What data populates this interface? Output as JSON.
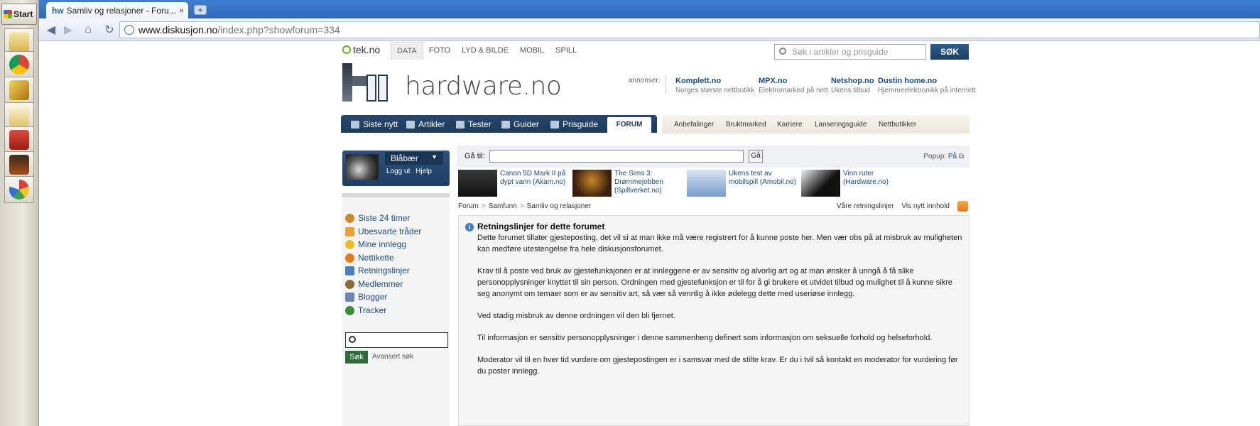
{
  "os": {
    "start_label": "Start",
    "icons": [
      "explorer-icon",
      "chrome-icon",
      "editor-icon",
      "mail-icon",
      "books-icon",
      "video-icon",
      "paint-icon"
    ]
  },
  "browser": {
    "tab_title": "Samliv og relasjoner - Foru...",
    "tab_close": "×",
    "newtab": "+",
    "url_host": "www.diskusjon.no",
    "url_path": "/index.php?showforum=334"
  },
  "site": {
    "tek_logo": "tek.no",
    "topnav": [
      "DATA",
      "FOTO",
      "LYD & BILDE",
      "MOBIL",
      "SPILL"
    ],
    "search_placeholder": "Søk i artikler og prisguide",
    "search_button": "SØK",
    "brand": "hardware.no",
    "ads_label": "annonser:",
    "ads": [
      {
        "name": "Komplett.no",
        "desc": "Norges største nettbutikk"
      },
      {
        "name": "MPX.no",
        "desc": "Elektromarked på nett"
      },
      {
        "name": "Netshop.no",
        "desc": "Ukens tilbud"
      },
      {
        "name": "Dustin home.no",
        "desc": "Hjemmeelektronikk på internett"
      }
    ],
    "mainnav": [
      "Siste nytt",
      "Artikler",
      "Tester",
      "Guider",
      "Prisguide"
    ],
    "forum_tab": "FORUM",
    "subnav": [
      "Anbefalinger",
      "Bruktmarked",
      "Karriere",
      "Lanseringsguide",
      "Nettbutikker"
    ]
  },
  "user": {
    "name": "Blåbær",
    "logout": "Logg ut",
    "help": "Hjelp"
  },
  "sidebar": {
    "items": [
      {
        "label": "Siste 24 timer",
        "color": "#c98a2a"
      },
      {
        "label": "Ubesvarte tråder",
        "color": "#e6a23a"
      },
      {
        "label": "Mine innlegg",
        "color": "#f0b92d"
      },
      {
        "label": "Nettikette",
        "color": "#e67a1a"
      },
      {
        "label": "Retningslinjer",
        "color": "#4a7fc0"
      },
      {
        "label": "Medlemmer",
        "color": "#8a6a3a"
      },
      {
        "label": "Blogger",
        "color": "#6d84b4"
      },
      {
        "label": "Tracker",
        "color": "#3d8a3a"
      }
    ],
    "search_button": "Søk",
    "advanced": "Avansert søk"
  },
  "content": {
    "goto_label": "Gå til:",
    "goto_button": "Gå",
    "popup_label": "Popup:",
    "popup_value": "På",
    "news": [
      {
        "title": "Canon 5D Mark II på dypt vann (Akam.no)"
      },
      {
        "title": "The Sims 3: Drømmejobben (Spillverket.no)"
      },
      {
        "title": "Ukens test av mobilspill (Amobil.no)"
      },
      {
        "title": "Vinn ruter (Hardware.no)"
      }
    ],
    "breadcrumb": [
      "Forum",
      "Samfunn",
      "Samliv og relasjoner"
    ],
    "right_links": [
      "Våre retningslinjer",
      "Vis nytt innhold"
    ],
    "guidelines_title": "Retningslinjer for dette forumet",
    "paragraphs": [
      "Dette forumet tillater gjesteposting, det vil si at man ikke må være registrert for å kunne poste her. Men vær obs på at misbruk av muligheten kan medføre utestengelse fra hele diskusjonsforumet.",
      "Krav til å poste ved bruk av gjestefunksjonen er at innleggene er av sensitiv og alvorlig art og at man ønsker å unngå å få slike personopplysninger knyttet til sin person. Ordningen med gjestefunksjon er til for å gi brukere et utvidet tilbud og mulighet til å kunne sikre seg anonymt om temaer som er av sensitiv art, så vær så vennlig å ikke ødelegg dette med useriøse innlegg.",
      "Ved stadig misbruk av denne ordningen vil den bli fjernet.",
      "Til informasjon er sensitiv personopplysninger i denne sammenheng definert som informasjon om seksuelle forhold og helseforhold.",
      "Moderator vil til en hver tid vurdere om gjestepostingen er i samsvar med de stilte krav. Er du i tvil så kontakt en moderator for vurdering før du poster innlegg."
    ]
  }
}
